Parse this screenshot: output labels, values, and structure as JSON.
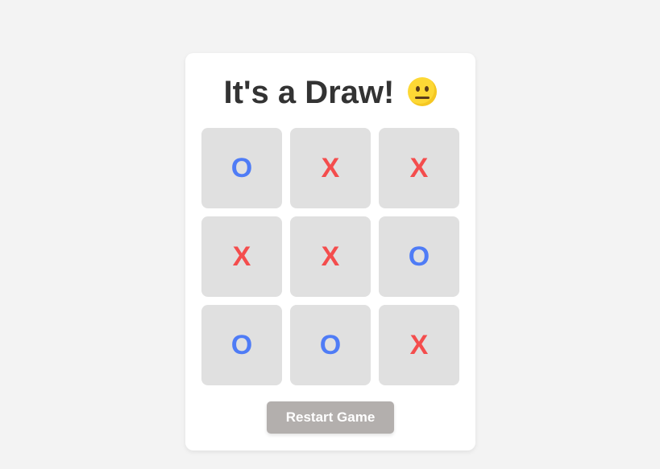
{
  "game": {
    "status_text": "It's a Draw!",
    "status_emoji": "neutral-face-emoji"
  },
  "board": {
    "cells": [
      "O",
      "X",
      "X",
      "X",
      "X",
      "O",
      "O",
      "O",
      "X"
    ]
  },
  "controls": {
    "restart_label": "Restart Game"
  },
  "colors": {
    "x_mark": "#f44d4d",
    "o_mark": "#4f7cf6",
    "cell_bg": "#e0e0e0",
    "button_bg": "#b3afad",
    "page_bg": "#f3f3f3"
  }
}
